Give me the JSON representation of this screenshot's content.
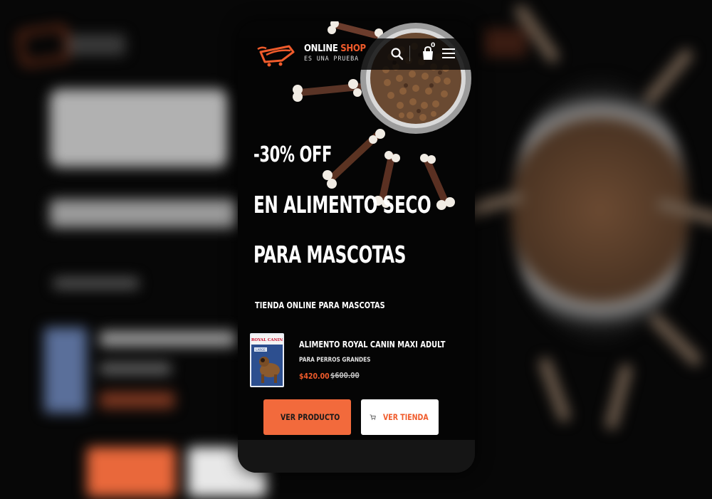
{
  "header": {
    "brand_primary": "ONLINE",
    "brand_accent": "SHOP",
    "brand_tagline": "ES UNA PRUEBA",
    "cart_count": "0",
    "icons": [
      "logo-icon",
      "search-icon",
      "shopping-bag-icon",
      "hamburger-menu-icon"
    ]
  },
  "hero": {
    "line1": "-30% OFF",
    "line2": "EN ALIMENTO SECO",
    "line3": "PARA MASCOTAS",
    "subtitle": "TIENDA ONLINE PARA MASCOTAS"
  },
  "product": {
    "name": "ALIMENTO ROYAL CANIN MAXI ADULT",
    "subtitle": "PARA PERROS GRANDES",
    "price": "$420.00",
    "old_price": "$600.00",
    "package_brand": "ROYAL CANIN",
    "package_size": "LARGE"
  },
  "buttons": {
    "primary_label": "VER PRODUCTO",
    "secondary_label": "VER TIENDA"
  },
  "colors": {
    "accent": "#f05b2b",
    "background": "#050505",
    "text": "#ffffff"
  }
}
